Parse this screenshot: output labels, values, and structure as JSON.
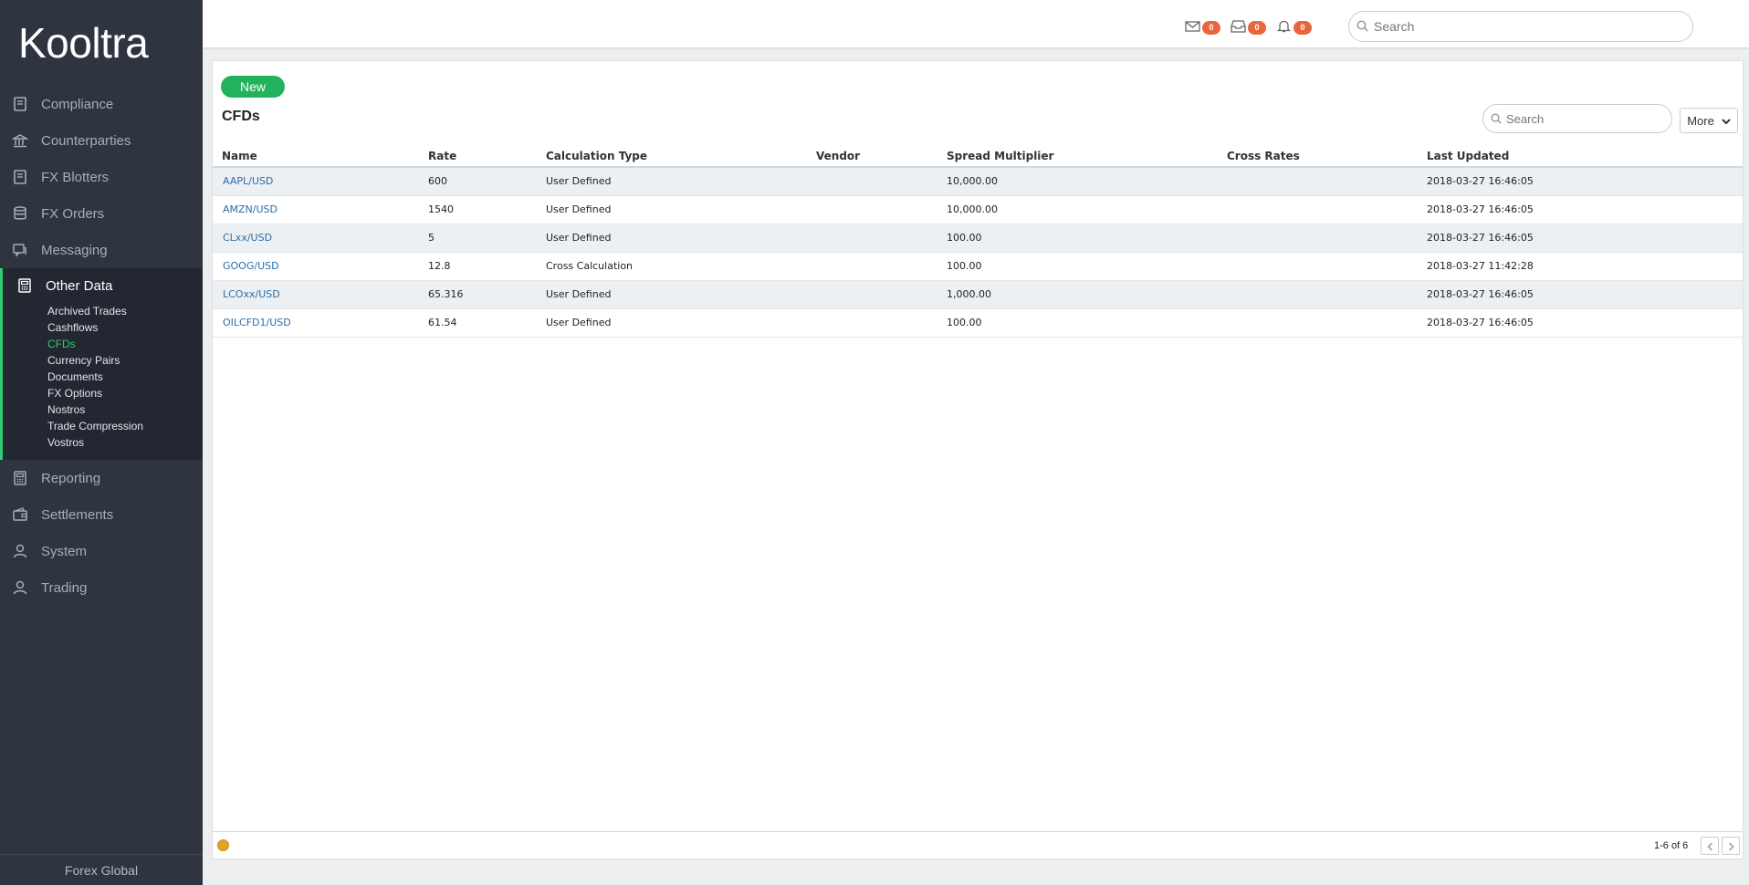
{
  "app": {
    "logo": "Kooltra",
    "footer": "Forex Global"
  },
  "sidebar": {
    "items": [
      {
        "label": "Compliance",
        "icon": "book-icon"
      },
      {
        "label": "Counterparties",
        "icon": "bank-icon"
      },
      {
        "label": "FX Blotters",
        "icon": "book-icon"
      },
      {
        "label": "FX Orders",
        "icon": "database-icon"
      },
      {
        "label": "Messaging",
        "icon": "chat-icon"
      }
    ],
    "active_group": {
      "label": "Other Data",
      "icon": "calculator-icon",
      "subitems": [
        "Archived Trades",
        "Cashflows",
        "CFDs",
        "Currency Pairs",
        "Documents",
        "FX Options",
        "Nostros",
        "Trade Compression",
        "Vostros"
      ],
      "active_subitem": "CFDs"
    },
    "items_after": [
      {
        "label": "Reporting",
        "icon": "calculator-icon"
      },
      {
        "label": "Settlements",
        "icon": "wallet-icon"
      },
      {
        "label": "System",
        "icon": "user-icon"
      },
      {
        "label": "Trading",
        "icon": "user-icon"
      }
    ]
  },
  "topbar": {
    "mail_count": "0",
    "inbox_count": "0",
    "bell_count": "0",
    "search_placeholder": "Search"
  },
  "card": {
    "new_label": "New",
    "title": "CFDs",
    "search_placeholder": "Search",
    "more_label": "More",
    "pager": "1-6 of 6"
  },
  "table": {
    "columns": [
      "Name",
      "Rate",
      "Calculation Type",
      "Vendor",
      "Spread Multiplier",
      "Cross Rates",
      "Last Updated"
    ],
    "rows": [
      [
        "AAPL/USD",
        "600",
        "User Defined",
        "",
        "10,000.00",
        "",
        "2018-03-27 16:46:05"
      ],
      [
        "AMZN/USD",
        "1540",
        "User Defined",
        "",
        "10,000.00",
        "",
        "2018-03-27 16:46:05"
      ],
      [
        "CLxx/USD",
        "5",
        "User Defined",
        "",
        "100.00",
        "",
        "2018-03-27 16:46:05"
      ],
      [
        "GOOG/USD",
        "12.8",
        "Cross Calculation",
        "",
        "100.00",
        "",
        "2018-03-27 11:42:28"
      ],
      [
        "LCOxx/USD",
        "65.316",
        "User Defined",
        "",
        "1,000.00",
        "",
        "2018-03-27 16:46:05"
      ],
      [
        "OILCFD1/USD",
        "61.54",
        "User Defined",
        "",
        "100.00",
        "",
        "2018-03-27 16:46:05"
      ]
    ]
  },
  "colors": {
    "sidebar_bg": "#2f3441",
    "accent_green": "#22b25b",
    "badge_orange": "#e8663d",
    "link_blue": "#2a6ea6"
  }
}
